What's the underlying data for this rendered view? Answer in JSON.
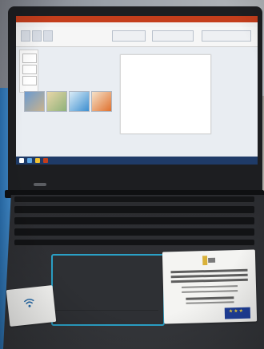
{
  "photo": {
    "description_free": true
  },
  "colors": {
    "laptop_body": "#1d1e21",
    "touchpad_accent": "#2aa0c6",
    "powerpoint_red": "#c43e1c",
    "taskbar_blue": "#1f3b68",
    "eu_blue": "#1f3f9a"
  },
  "icons": {
    "laptop": "laptop-icon",
    "touchpad": "touchpad-icon",
    "eu_flag": "eu-flag-icon"
  }
}
